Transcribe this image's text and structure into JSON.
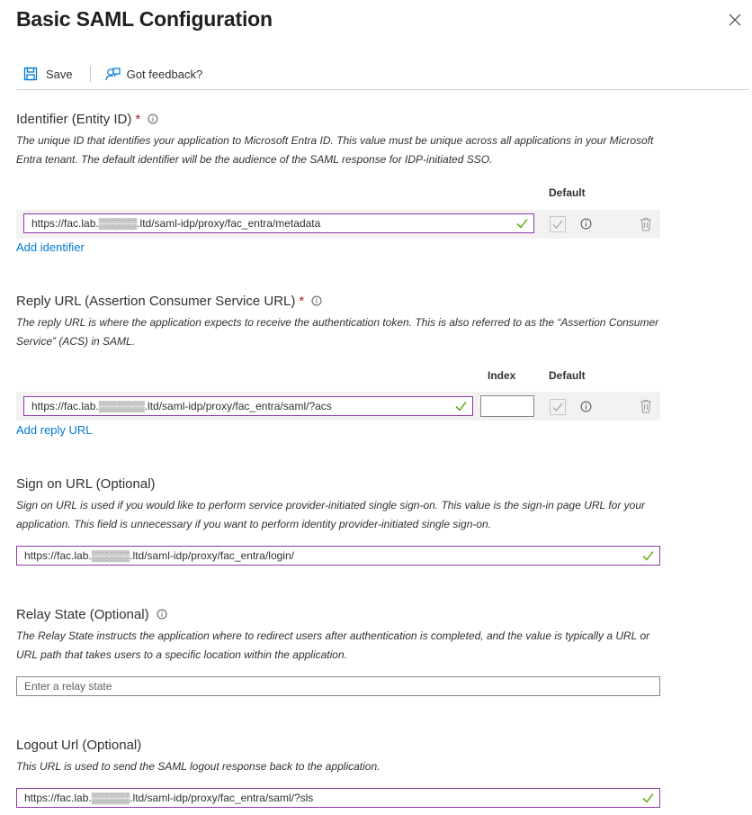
{
  "header": {
    "title": "Basic SAML Configuration",
    "close_icon": "close-icon"
  },
  "toolbar": {
    "save_label": "Save",
    "feedback_label": "Got feedback?"
  },
  "identifier": {
    "title": "Identifier (Entity ID)",
    "required_mark": "*",
    "description": "The unique ID that identifies your application to Microsoft Entra ID. This value must be unique across all applications in your Microsoft Entra tenant. The default identifier will be the audience of the SAML response for IDP-initiated SSO.",
    "default_header": "Default",
    "value": "https://fac.lab.▒▒▒▒▒.ltd/saml-idp/proxy/fac_entra/metadata",
    "default_checked": true,
    "add_link": "Add identifier"
  },
  "reply_url": {
    "title": "Reply URL (Assertion Consumer Service URL)",
    "required_mark": "*",
    "description": "The reply URL is where the application expects to receive the authentication token. This is also referred to as the “Assertion Consumer Service” (ACS) in SAML.",
    "index_header": "Index",
    "default_header": "Default",
    "value": "https://fac.lab.▒▒▒▒▒▒.ltd/saml-idp/proxy/fac_entra/saml/?acs",
    "index_value": "",
    "default_checked": true,
    "add_link": "Add reply URL"
  },
  "sign_on": {
    "title": "Sign on URL (Optional)",
    "description": "Sign on URL is used if you would like to perform service provider-initiated single sign-on. This value is the sign-in page URL for your application. This field is unnecessary if you want to perform identity provider-initiated single sign-on.",
    "value": "https://fac.lab.▒▒▒▒▒.ltd/saml-idp/proxy/fac_entra/login/"
  },
  "relay_state": {
    "title": "Relay State (Optional)",
    "description": "The Relay State instructs the application where to redirect users after authentication is completed, and the value is typically a URL or URL path that takes users to a specific location within the application.",
    "placeholder": "Enter a relay state"
  },
  "logout": {
    "title": "Logout Url (Optional)",
    "description": "This URL is used to send the SAML logout response back to the application.",
    "value": "https://fac.lab.▒▒▒▒▒.ltd/saml-idp/proxy/fac_entra/saml/?sls"
  },
  "colors": {
    "accent": "#0078d4",
    "field_border": "#8a3aa8",
    "check": "#57a300",
    "required": "#a4262c"
  }
}
